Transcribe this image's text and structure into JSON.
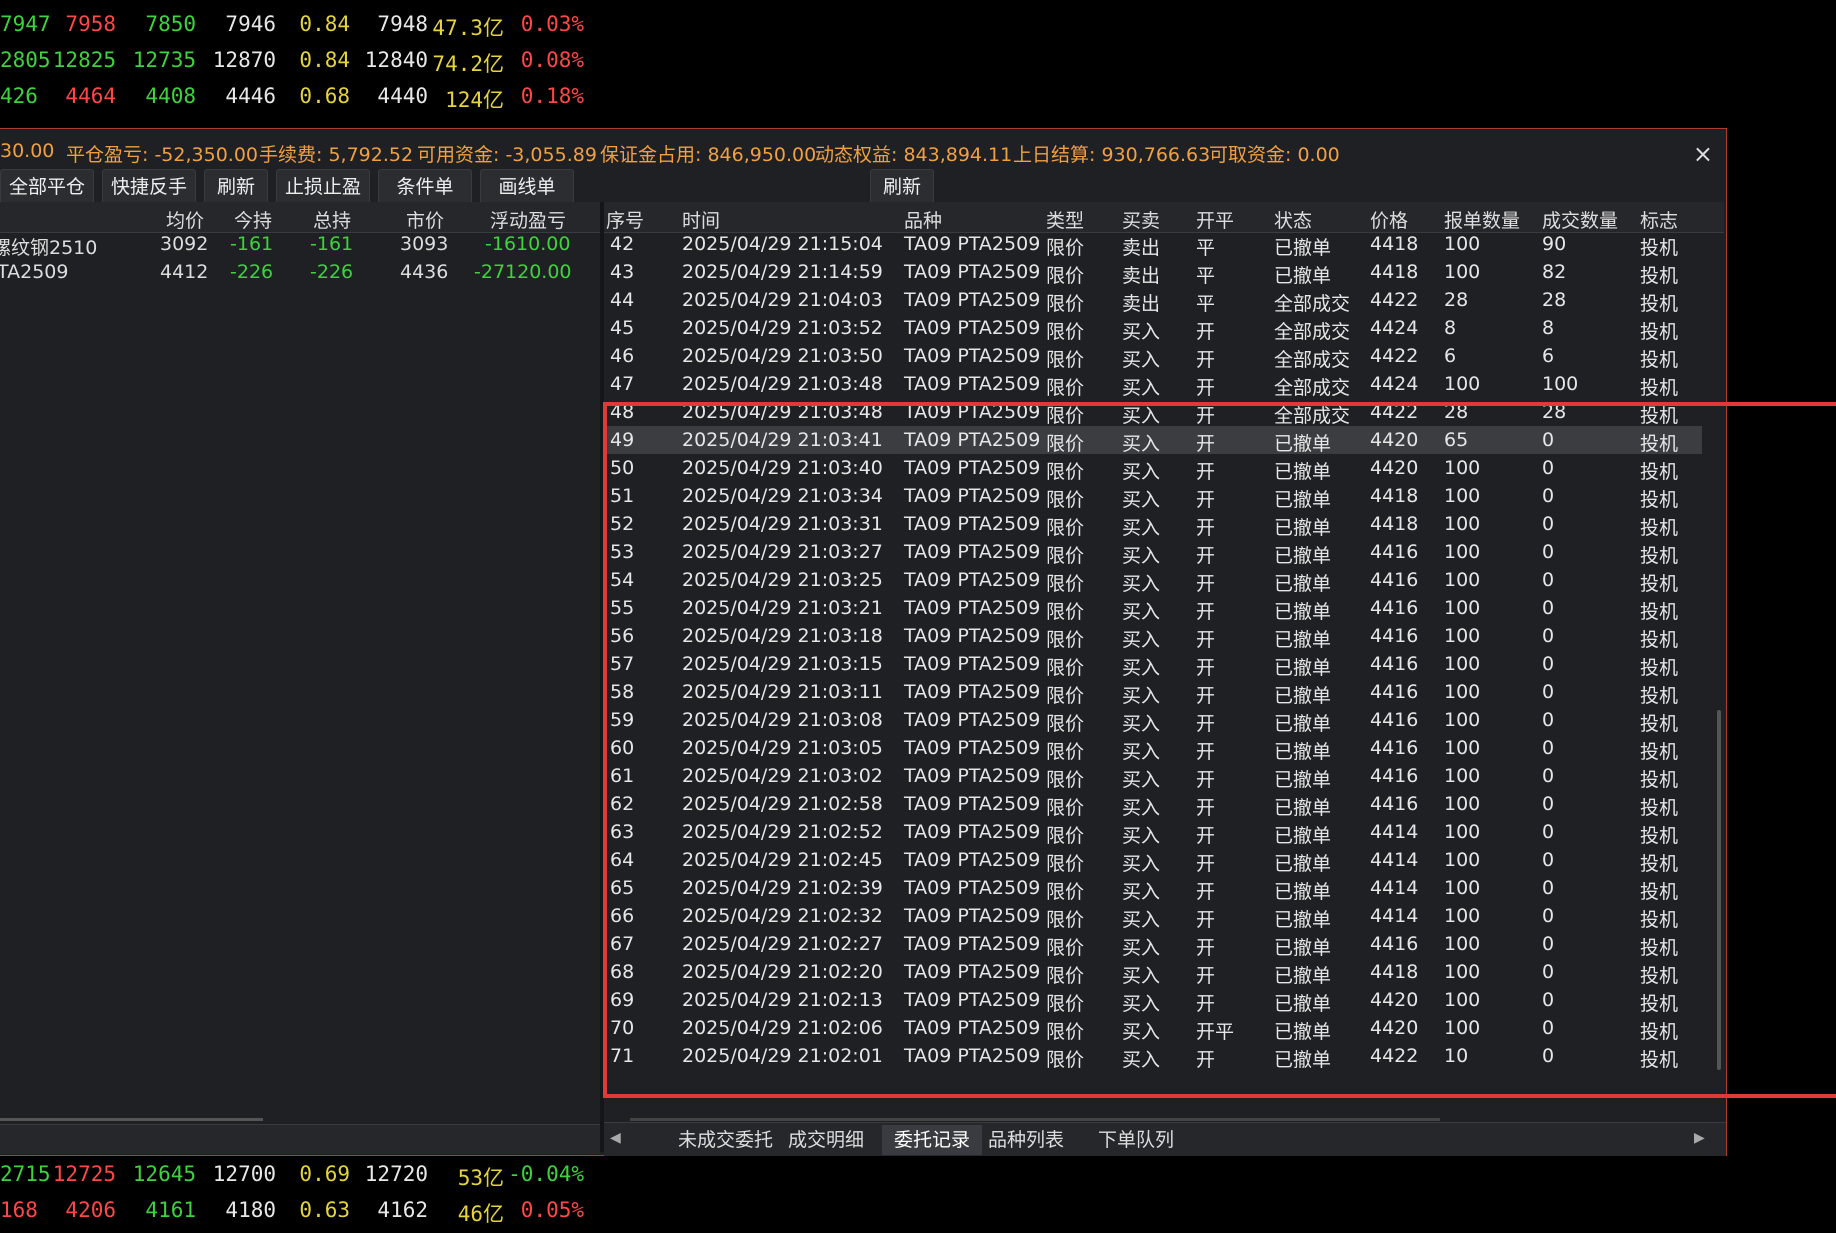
{
  "quotes_top": [
    {
      "cols": [
        "7947",
        "7958",
        "7850",
        "7946",
        "0.84",
        "7948",
        "47.3亿",
        "0.03%"
      ],
      "colors": [
        "green",
        "red",
        "green",
        "white",
        "yellow",
        "white",
        "yellow",
        "red"
      ]
    },
    {
      "cols": [
        "2805",
        "12825",
        "12735",
        "12870",
        "0.84",
        "12840",
        "74.2亿",
        "0.08%"
      ],
      "colors": [
        "green",
        "green",
        "green",
        "white",
        "yellow",
        "white",
        "yellow",
        "red"
      ]
    },
    {
      "cols": [
        "426",
        "4464",
        "4408",
        "4446",
        "0.68",
        "4440",
        "124亿",
        "0.18%"
      ],
      "colors": [
        "green",
        "red",
        "green",
        "white",
        "yellow",
        "white",
        "yellow",
        "red"
      ]
    }
  ],
  "quotes_bottom": [
    {
      "cols": [
        "2715",
        "12725",
        "12645",
        "12700",
        "0.69",
        "12720",
        "53亿",
        "-0.04%"
      ],
      "colors": [
        "green",
        "red",
        "green",
        "white",
        "yellow",
        "white",
        "yellow",
        "green"
      ]
    },
    {
      "cols": [
        "168",
        "4206",
        "4161",
        "4180",
        "0.63",
        "4162",
        "46亿",
        "0.05%"
      ],
      "colors": [
        "red",
        "red",
        "green",
        "white",
        "yellow",
        "white",
        "yellow",
        "red"
      ]
    }
  ],
  "summary": {
    "prefix": "30.00",
    "close_pnl": "平仓盈亏: -52,350.00",
    "fee": "手续费: 5,792.52",
    "available": "可用资金: -3,055.89",
    "margin": "保证金占用: 846,950.00",
    "dynamic_equity": "动态权益: 843,894.11",
    "last_settle": "上日结算: 930,766.63",
    "withdrawable": "可取资金: 0.00",
    "close": "×"
  },
  "toolbar": {
    "close_all": "全部平仓",
    "quick_reverse": "快捷反手",
    "refresh": "刷新",
    "stop_loss": "止损止盈",
    "condition": "条件单",
    "draw_order": "画线单",
    "refresh_right": "刷新"
  },
  "positions": {
    "headers": [
      "均价",
      "今持",
      "总持",
      "市价",
      "浮动盈亏"
    ],
    "rows": [
      {
        "name": "螺纹钢2510",
        "avg": "3092",
        "today": "-161",
        "total": "-161",
        "price": "3093",
        "pnl": "-1610.00"
      },
      {
        "name": "TA2509",
        "avg": "4412",
        "today": "-226",
        "total": "-226",
        "price": "4436",
        "pnl": "-27120.00"
      }
    ]
  },
  "orders": {
    "headers": [
      "序号",
      "时间",
      "品种",
      "类型",
      "买卖",
      "开平",
      "状态",
      "价格",
      "报单数量",
      "成交数量",
      "标志"
    ],
    "selected_index": 49,
    "rows": [
      [
        "42",
        "2025/04/29 21:15:04",
        "TA09 PTA2509",
        "限价",
        "卖出",
        "平",
        "已撤单",
        "4418",
        "100",
        "90",
        "投机"
      ],
      [
        "43",
        "2025/04/29 21:14:59",
        "TA09 PTA2509",
        "限价",
        "卖出",
        "平",
        "已撤单",
        "4418",
        "100",
        "82",
        "投机"
      ],
      [
        "44",
        "2025/04/29 21:04:03",
        "TA09 PTA2509",
        "限价",
        "卖出",
        "平",
        "全部成交",
        "4422",
        "28",
        "28",
        "投机"
      ],
      [
        "45",
        "2025/04/29 21:03:52",
        "TA09 PTA2509",
        "限价",
        "买入",
        "开",
        "全部成交",
        "4424",
        "8",
        "8",
        "投机"
      ],
      [
        "46",
        "2025/04/29 21:03:50",
        "TA09 PTA2509",
        "限价",
        "买入",
        "开",
        "全部成交",
        "4422",
        "6",
        "6",
        "投机"
      ],
      [
        "47",
        "2025/04/29 21:03:48",
        "TA09 PTA2509",
        "限价",
        "买入",
        "开",
        "全部成交",
        "4424",
        "100",
        "100",
        "投机"
      ],
      [
        "48",
        "2025/04/29 21:03:48",
        "TA09 PTA2509",
        "限价",
        "买入",
        "开",
        "全部成交",
        "4422",
        "28",
        "28",
        "投机"
      ],
      [
        "49",
        "2025/04/29 21:03:41",
        "TA09 PTA2509",
        "限价",
        "买入",
        "开",
        "已撤单",
        "4420",
        "65",
        "0",
        "投机"
      ],
      [
        "50",
        "2025/04/29 21:03:40",
        "TA09 PTA2509",
        "限价",
        "买入",
        "开",
        "已撤单",
        "4420",
        "100",
        "0",
        "投机"
      ],
      [
        "51",
        "2025/04/29 21:03:34",
        "TA09 PTA2509",
        "限价",
        "买入",
        "开",
        "已撤单",
        "4418",
        "100",
        "0",
        "投机"
      ],
      [
        "52",
        "2025/04/29 21:03:31",
        "TA09 PTA2509",
        "限价",
        "买入",
        "开",
        "已撤单",
        "4418",
        "100",
        "0",
        "投机"
      ],
      [
        "53",
        "2025/04/29 21:03:27",
        "TA09 PTA2509",
        "限价",
        "买入",
        "开",
        "已撤单",
        "4416",
        "100",
        "0",
        "投机"
      ],
      [
        "54",
        "2025/04/29 21:03:25",
        "TA09 PTA2509",
        "限价",
        "买入",
        "开",
        "已撤单",
        "4416",
        "100",
        "0",
        "投机"
      ],
      [
        "55",
        "2025/04/29 21:03:21",
        "TA09 PTA2509",
        "限价",
        "买入",
        "开",
        "已撤单",
        "4416",
        "100",
        "0",
        "投机"
      ],
      [
        "56",
        "2025/04/29 21:03:18",
        "TA09 PTA2509",
        "限价",
        "买入",
        "开",
        "已撤单",
        "4416",
        "100",
        "0",
        "投机"
      ],
      [
        "57",
        "2025/04/29 21:03:15",
        "TA09 PTA2509",
        "限价",
        "买入",
        "开",
        "已撤单",
        "4416",
        "100",
        "0",
        "投机"
      ],
      [
        "58",
        "2025/04/29 21:03:11",
        "TA09 PTA2509",
        "限价",
        "买入",
        "开",
        "已撤单",
        "4416",
        "100",
        "0",
        "投机"
      ],
      [
        "59",
        "2025/04/29 21:03:08",
        "TA09 PTA2509",
        "限价",
        "买入",
        "开",
        "已撤单",
        "4416",
        "100",
        "0",
        "投机"
      ],
      [
        "60",
        "2025/04/29 21:03:05",
        "TA09 PTA2509",
        "限价",
        "买入",
        "开",
        "已撤单",
        "4416",
        "100",
        "0",
        "投机"
      ],
      [
        "61",
        "2025/04/29 21:03:02",
        "TA09 PTA2509",
        "限价",
        "买入",
        "开",
        "已撤单",
        "4416",
        "100",
        "0",
        "投机"
      ],
      [
        "62",
        "2025/04/29 21:02:58",
        "TA09 PTA2509",
        "限价",
        "买入",
        "开",
        "已撤单",
        "4416",
        "100",
        "0",
        "投机"
      ],
      [
        "63",
        "2025/04/29 21:02:52",
        "TA09 PTA2509",
        "限价",
        "买入",
        "开",
        "已撤单",
        "4414",
        "100",
        "0",
        "投机"
      ],
      [
        "64",
        "2025/04/29 21:02:45",
        "TA09 PTA2509",
        "限价",
        "买入",
        "开",
        "已撤单",
        "4414",
        "100",
        "0",
        "投机"
      ],
      [
        "65",
        "2025/04/29 21:02:39",
        "TA09 PTA2509",
        "限价",
        "买入",
        "开",
        "已撤单",
        "4414",
        "100",
        "0",
        "投机"
      ],
      [
        "66",
        "2025/04/29 21:02:32",
        "TA09 PTA2509",
        "限价",
        "买入",
        "开",
        "已撤单",
        "4414",
        "100",
        "0",
        "投机"
      ],
      [
        "67",
        "2025/04/29 21:02:27",
        "TA09 PTA2509",
        "限价",
        "买入",
        "开",
        "已撤单",
        "4416",
        "100",
        "0",
        "投机"
      ],
      [
        "68",
        "2025/04/29 21:02:20",
        "TA09 PTA2509",
        "限价",
        "买入",
        "开",
        "已撤单",
        "4418",
        "100",
        "0",
        "投机"
      ],
      [
        "69",
        "2025/04/29 21:02:13",
        "TA09 PTA2509",
        "限价",
        "买入",
        "开",
        "已撤单",
        "4420",
        "100",
        "0",
        "投机"
      ],
      [
        "70",
        "2025/04/29 21:02:06",
        "TA09 PTA2509",
        "限价",
        "买入",
        "开平",
        "已撤单",
        "4420",
        "100",
        "0",
        "投机"
      ],
      [
        "71",
        "2025/04/29 21:02:01",
        "TA09 PTA2509",
        "限价",
        "买入",
        "开",
        "已撤单",
        "4422",
        "10",
        "0",
        "投机"
      ]
    ]
  },
  "tabs": [
    "未成交委托",
    "成交明细",
    "委托记录",
    "品种列表",
    "下单队列"
  ],
  "active_tab": "委托记录",
  "icons": {
    "left_arrow": "◀",
    "right_arrow": "▶"
  },
  "colors": {
    "negative": "#3dd33d",
    "positive": "#ff4747",
    "summary": "#f0a040",
    "highlight": "#e23838"
  }
}
